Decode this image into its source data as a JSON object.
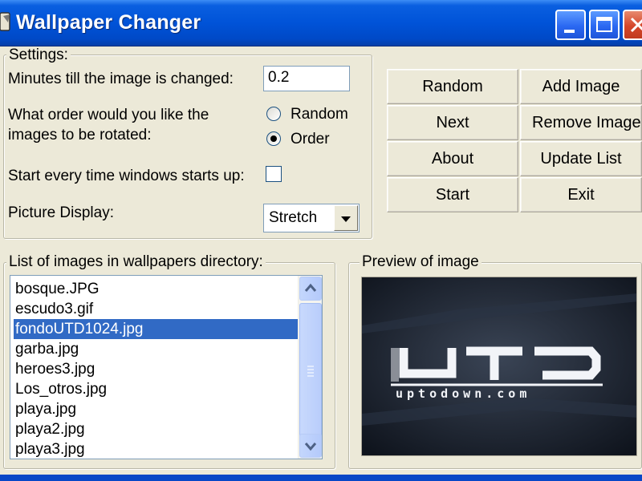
{
  "window": {
    "title": "Wallpaper Changer",
    "controls": [
      "minimize",
      "maximize",
      "close"
    ]
  },
  "settings": {
    "group_label": "Settings:",
    "minutes_label": "Minutes till the image is changed:",
    "minutes_value": "0.2",
    "order_label_line1": "What order would you like the",
    "order_label_line2": "images to be rotated:",
    "order_options": [
      {
        "label": "Random",
        "selected": false
      },
      {
        "label": "Order",
        "selected": true
      }
    ],
    "startup_label": "Start every time windows starts up:",
    "startup_checked": false,
    "display_label": "Picture Display:",
    "display_value": "Stretch"
  },
  "buttons": {
    "random": "Random",
    "add_image": "Add Image",
    "next": "Next",
    "remove_image": "Remove Image",
    "about": "About",
    "update_list": "Update List",
    "start": "Start",
    "exit": "Exit"
  },
  "image_list": {
    "group_label": "List of images in wallpapers directory:",
    "items": [
      "bosque.JPG",
      "escudo3.gif",
      "fondoUTD1024.jpg",
      "garba.jpg",
      "heroes3.jpg",
      "Los_otros.jpg",
      "playa.jpg",
      "playa2.jpg",
      "playa3.jpg"
    ],
    "selected_index": 2
  },
  "preview": {
    "group_label": "Preview of image",
    "image_text": "UTD",
    "image_subtext": "uptodown.com"
  },
  "icons": {
    "app": "pencil-icon",
    "scroll_up": "chevron-up-icon",
    "scroll_down": "chevron-down-icon",
    "combo_arrow": "dropdown-arrow-icon"
  },
  "colors": {
    "titlebar": "#0053d8",
    "window_bg": "#ece9d8",
    "selection": "#316ac5",
    "close_button": "#d5462a",
    "preview_bg": "#1a2130"
  }
}
